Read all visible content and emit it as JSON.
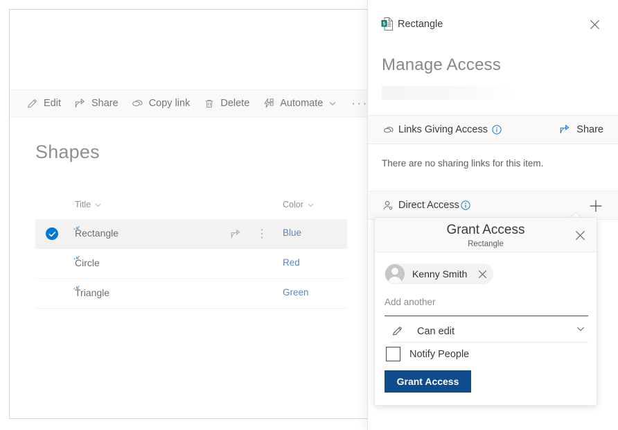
{
  "commandbar": {
    "items": [
      {
        "label": "Edit",
        "icon": "pencil-icon",
        "chevron": false
      },
      {
        "label": "Share",
        "icon": "share-icon",
        "chevron": false
      },
      {
        "label": "Copy link",
        "icon": "link-icon",
        "chevron": false
      },
      {
        "label": "Delete",
        "icon": "trash-icon",
        "chevron": false
      },
      {
        "label": "Automate",
        "icon": "automate-icon",
        "chevron": true
      }
    ],
    "overflow_label": "···"
  },
  "list": {
    "title": "Shapes",
    "columns": [
      {
        "label": "Title"
      },
      {
        "label": "Color"
      }
    ],
    "rows": [
      {
        "title": "Rectangle",
        "color": "Blue",
        "selected": true
      },
      {
        "title": "Circle",
        "color": "Red",
        "selected": false
      },
      {
        "title": "Triangle",
        "color": "Green",
        "selected": false
      }
    ]
  },
  "panel": {
    "file_name": "Rectangle",
    "file_icon": "list-item-icon",
    "close_icon": "close-icon",
    "heading": "Manage Access",
    "links_section": {
      "title": "Links Giving Access",
      "icon": "link-icon",
      "info_icon": "info-icon",
      "action_label": "Share",
      "action_icon": "share-icon",
      "empty_text": "There are no sharing links for this item."
    },
    "direct_section": {
      "title": "Direct Access",
      "icon": "person-icon",
      "info_icon": "info-icon",
      "add_icon": "plus-icon"
    }
  },
  "grant_access": {
    "title": "Grant Access",
    "subtitle": "Rectangle",
    "close_icon": "close-icon",
    "person": {
      "name": "Kenny Smith",
      "avatar_icon": "person-avatar-icon",
      "remove_icon": "close-icon"
    },
    "add_another_placeholder": "Add another",
    "permission": {
      "label": "Can edit",
      "icon": "pencil-icon",
      "chevron_icon": "chevron-down-icon"
    },
    "notify": {
      "label": "Notify People",
      "checked": false
    },
    "submit_label": "Grant Access"
  },
  "colors": {
    "accent_blue": "#0078d4",
    "button_blue": "#0e4c8c",
    "link_blue": "#5b88c4",
    "panel_bg": "#ffffff",
    "section_bg": "#faf9f8",
    "selected_row_bg": "#f3f2f1"
  }
}
